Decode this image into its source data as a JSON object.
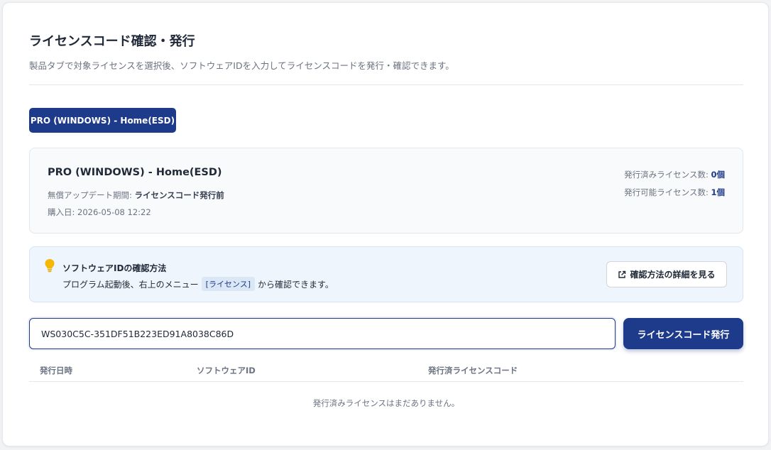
{
  "header": {
    "title": "ライセンスコード確認・発行",
    "description": "製品タブで対象ライセンスを選択後、ソフトウェアIDを入力してライセンスコードを発行・確認できます。"
  },
  "product_tabs": [
    {
      "label": "PRO (WINDOWS) - Home(ESD)",
      "active": true
    }
  ],
  "product": {
    "name": "PRO (WINDOWS) - Home(ESD)",
    "update_period_label": "無償アップデート期間: ",
    "update_period_value": "ライセンスコード発行前",
    "purchase_date_label": "購入日: ",
    "purchase_date_value": "2026-05-08 12:22",
    "issued_label": "発行済みライセンス数: ",
    "issued_value": "0個",
    "available_label": "発行可能ライセンス数: ",
    "available_value": "1個"
  },
  "info": {
    "icon": "lightbulb-icon",
    "title": "ソフトウェアIDの確認方法",
    "text_before": "プログラム起動後、右上のメニュー",
    "menu_code": "[ライセンス]",
    "text_after": "から確認できます。",
    "detail_button_icon": "external-link-icon",
    "detail_button_label": "確認方法の詳細を見る"
  },
  "form": {
    "software_id_value": "WS030C5C-351DF51B223ED91A8038C86D",
    "issue_button_label": "ライセンスコード発行"
  },
  "table": {
    "columns": [
      "発行日時",
      "ソフトウェアID",
      "発行済ライセンスコード"
    ],
    "rows": [],
    "empty_message": "発行済みライセンスはまだありません。"
  },
  "colors": {
    "primary": "#1e3a8a",
    "info_background": "#eef5fd",
    "bulb": "#f5b800"
  }
}
